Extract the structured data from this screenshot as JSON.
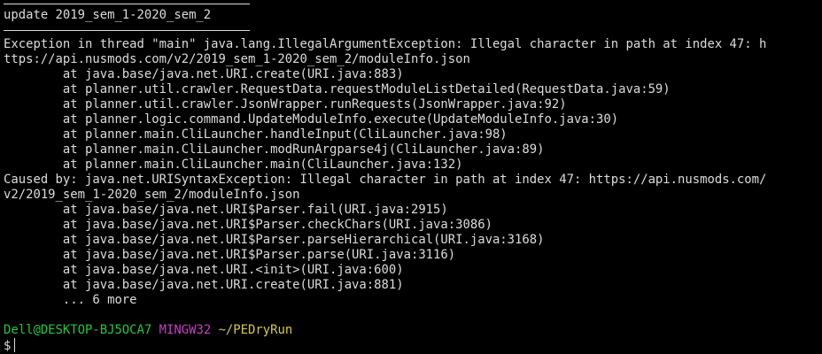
{
  "terminal": {
    "header_command": "update 2019_sem_1-2020_sem_2",
    "lines": [
      "Exception in thread \"main\" java.lang.IllegalArgumentException: Illegal character in path at index 47: h",
      "ttps://api.nusmods.com/v2/2019_sem_1-2020_sem_2/moduleInfo.json",
      "        at java.base/java.net.URI.create(URI.java:883)",
      "        at planner.util.crawler.RequestData.requestModuleListDetailed(RequestData.java:59)",
      "        at planner.util.crawler.JsonWrapper.runRequests(JsonWrapper.java:92)",
      "        at planner.logic.command.UpdateModuleInfo.execute(UpdateModuleInfo.java:30)",
      "        at planner.main.CliLauncher.handleInput(CliLauncher.java:98)",
      "        at planner.main.CliLauncher.modRunArgparse4j(CliLauncher.java:89)",
      "        at planner.main.CliLauncher.main(CliLauncher.java:132)",
      "Caused by: java.net.URISyntaxException: Illegal character in path at index 47: https://api.nusmods.com/",
      "v2/2019_sem_1-2020_sem_2/moduleInfo.json",
      "        at java.base/java.net.URI$Parser.fail(URI.java:2915)",
      "        at java.base/java.net.URI$Parser.checkChars(URI.java:3086)",
      "        at java.base/java.net.URI$Parser.parseHierarchical(URI.java:3168)",
      "        at java.base/java.net.URI$Parser.parse(URI.java:3116)",
      "        at java.base/java.net.URI.<init>(URI.java:600)",
      "        at java.base/java.net.URI.create(URI.java:881)",
      "        ... 6 more"
    ],
    "prompt": {
      "user_host": "Dell@DESKTOP-BJ5OCA7",
      "system": "MINGW32",
      "path": "~/PEDryRun",
      "symbol": "$"
    },
    "colors": {
      "background": "#000000",
      "text": "#dcdcdc",
      "user_host": "#22c83c",
      "system": "#c83ec8",
      "path": "#d7c84a"
    }
  }
}
